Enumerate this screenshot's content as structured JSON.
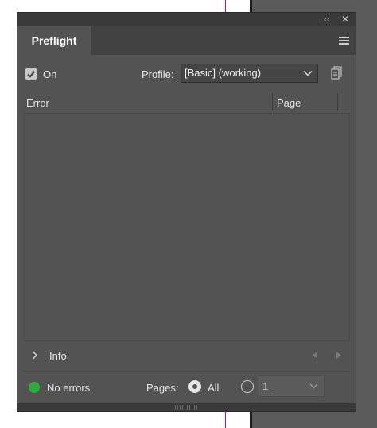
{
  "panel": {
    "title": "Preflight",
    "titlebar": {
      "collapse_glyph": "‹‹",
      "close_glyph": "✕"
    },
    "on_label": "On",
    "on_checked": true,
    "profile_label": "Profile:",
    "profile_value": "[Basic] (working)",
    "columns": {
      "error": "Error",
      "page": "Page"
    },
    "info_label": "Info",
    "status_text": "No errors",
    "status_color": "#2faa3c",
    "pages_label": "Pages:",
    "all_label": "All",
    "range_value": "1"
  },
  "icons": {
    "collapse": "double-chevron-left-icon",
    "close": "close-icon",
    "menu": "hamburger-menu-icon",
    "checkbox": "checkmark-icon",
    "dropdown": "chevron-down-icon",
    "profile_define": "profile-definition-icon",
    "info": "chevron-right-icon",
    "prev": "triangle-left-icon",
    "next": "triangle-right-icon"
  }
}
